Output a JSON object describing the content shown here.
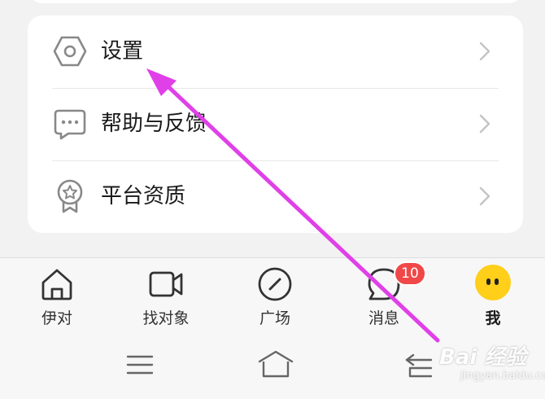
{
  "menu": {
    "items": [
      {
        "label": "设置",
        "icon": "settings-hexagon-icon"
      },
      {
        "label": "帮助与反馈",
        "icon": "chat-bubble-icon"
      },
      {
        "label": "平台资质",
        "icon": "award-badge-icon"
      }
    ]
  },
  "tabbar": {
    "tabs": [
      {
        "label": "伊对",
        "icon": "home-icon"
      },
      {
        "label": "找对象",
        "icon": "video-camera-icon"
      },
      {
        "label": "广场",
        "icon": "compass-icon"
      },
      {
        "label": "消息",
        "icon": "message-icon",
        "badge": "10"
      },
      {
        "label": "我",
        "icon": "avatar-face-icon",
        "active": true
      }
    ]
  },
  "system_nav": {
    "buttons": [
      "menu-icon",
      "home-outline-icon",
      "back-icon"
    ]
  },
  "watermark": {
    "main": "Bai 经验",
    "sub": "jingyan.baidu.com"
  },
  "colors": {
    "annotation_arrow": "#e040e8",
    "badge": "#f04848",
    "avatar": "#ffcf1a"
  }
}
